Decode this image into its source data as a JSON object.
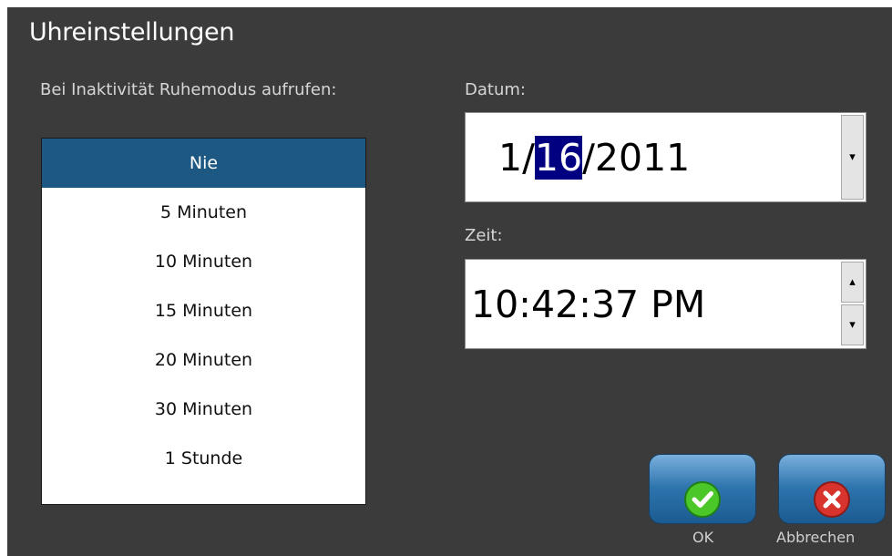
{
  "dialog": {
    "title": "Uhreinstellungen"
  },
  "sleep": {
    "label": "Bei Inaktivität Ruhemodus aufrufen:",
    "options": [
      "Nie",
      "5 Minuten",
      "10 Minuten",
      "15 Minuten",
      "20 Minuten",
      "30 Minuten",
      "1 Stunde"
    ],
    "selected": "Nie"
  },
  "date": {
    "label": "Datum:",
    "month": "1",
    "day": "16",
    "year": "2011",
    "separator": "/"
  },
  "time": {
    "label": "Zeit:",
    "value": "10:42:37 PM"
  },
  "buttons": {
    "ok": "OK",
    "cancel": "Abbrechen"
  },
  "icons": {
    "date_dropdown": "dropdown-arrow-icon",
    "time_increment": "up-arrow-icon",
    "time_decrement": "down-arrow-icon",
    "ok": "checkmark-icon",
    "cancel": "x-icon"
  },
  "colors": {
    "background": "#3b3b3b",
    "selected_item": "#1d5882",
    "date_highlight": "#000080",
    "ok_icon": "#4cc72a",
    "cancel_icon": "#d8342d"
  }
}
